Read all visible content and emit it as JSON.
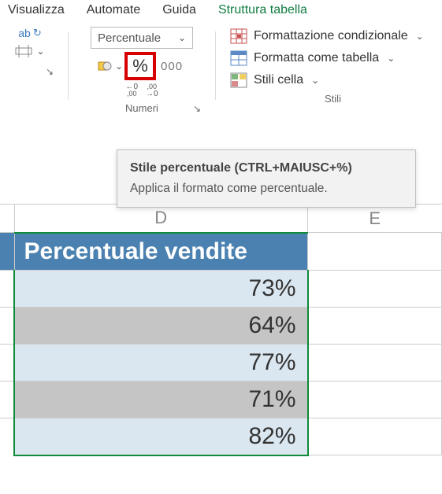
{
  "tabs": {
    "view": "Visualizza",
    "automate": "Automate",
    "guide": "Guida",
    "structure": "Struttura tabella"
  },
  "number_group": {
    "format_name": "Percentuale",
    "currency_label": "€",
    "percent_label": "%",
    "thousands_label": "000",
    "dec_inc_top": "←0",
    "dec_inc_bot": ",00",
    "dec_dec_top": ",00",
    "dec_dec_bot": "→0",
    "label": "Numeri"
  },
  "styles_group": {
    "conditional": "Formattazione condizionale",
    "format_table": "Formatta come tabella",
    "cell_styles": "Stili cella",
    "label": "Stili"
  },
  "tooltip": {
    "title": "Stile percentuale (CTRL+MAIUSC+%)",
    "body": "Applica il formato come percentuale."
  },
  "columns": {
    "d": "D",
    "e": "E"
  },
  "header": "Percentuale vendite",
  "rows": [
    "73%",
    "64%",
    "77%",
    "71%",
    "82%"
  ]
}
